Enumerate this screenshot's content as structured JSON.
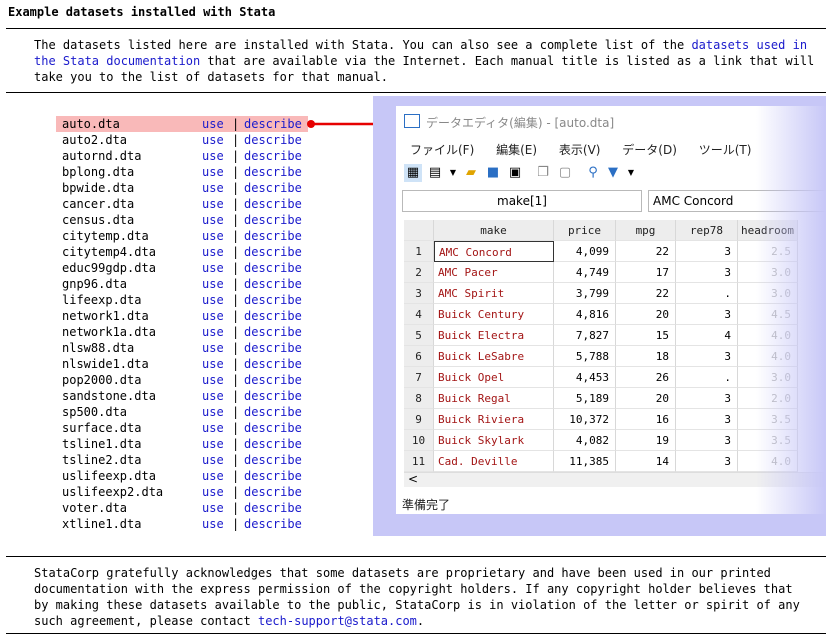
{
  "page": {
    "title": "Example datasets installed with Stata",
    "intro_1": "The datasets listed here are installed with Stata.  You can also see a complete list of the ",
    "intro_link": "datasets used in the Stata documentation",
    "intro_2": " that are available via the Internet.  Each manual title is listed as a link that will take you to the list of datasets for that manual.",
    "use_label": "use",
    "sep": "|",
    "describe_label": "describe",
    "datasets": [
      "auto.dta",
      "auto2.dta",
      "autornd.dta",
      "bplong.dta",
      "bpwide.dta",
      "cancer.dta",
      "census.dta",
      "citytemp.dta",
      "citytemp4.dta",
      "educ99gdp.dta",
      "gnp96.dta",
      "lifeexp.dta",
      "network1.dta",
      "network1a.dta",
      "nlsw88.dta",
      "nlswide1.dta",
      "pop2000.dta",
      "sandstone.dta",
      "sp500.dta",
      "surface.dta",
      "tsline1.dta",
      "tsline2.dta",
      "uslifeexp.dta",
      "uslifeexp2.dta",
      "voter.dta",
      "xtline1.dta"
    ],
    "highlighted": "auto.dta",
    "foot_1": "StataCorp gratefully acknowledges that some datasets are proprietary and have been used in our printed documentation with the express permission of the copyright holders. If any copyright holder believes that by making these datasets available to the public, StataCorp is in violation of the letter or spirit of any such agreement, please contact ",
    "foot_link": "tech-support@stata.com",
    "foot_2": "."
  },
  "editor": {
    "title": "データエディタ(編集) - [auto.dta]",
    "menus": [
      "ファイル(F)",
      "編集(E)",
      "表示(V)",
      "データ(D)",
      "ツール(T)"
    ],
    "cell_ref": "make[1]",
    "cell_value": "AMC Concord",
    "columns": [
      "make",
      "price",
      "mpg",
      "rep78",
      "headroom"
    ],
    "rows": [
      [
        "1",
        "AMC Concord",
        "4,099",
        "22",
        "3",
        "2.5"
      ],
      [
        "2",
        "AMC Pacer",
        "4,749",
        "17",
        "3",
        "3.0"
      ],
      [
        "3",
        "AMC Spirit",
        "3,799",
        "22",
        ".",
        "3.0"
      ],
      [
        "4",
        "Buick Century",
        "4,816",
        "20",
        "3",
        "4.5"
      ],
      [
        "5",
        "Buick Electra",
        "7,827",
        "15",
        "4",
        "4.0"
      ],
      [
        "6",
        "Buick LeSabre",
        "5,788",
        "18",
        "3",
        "4.0"
      ],
      [
        "7",
        "Buick Opel",
        "4,453",
        "26",
        ".",
        "3.0"
      ],
      [
        "8",
        "Buick Regal",
        "5,189",
        "20",
        "3",
        "2.0"
      ],
      [
        "9",
        "Buick Riviera",
        "10,372",
        "16",
        "3",
        "3.5"
      ],
      [
        "10",
        "Buick Skylark",
        "4,082",
        "19",
        "3",
        "3.5"
      ],
      [
        "11",
        "Cad. Deville",
        "11,385",
        "14",
        "3",
        "4.0"
      ]
    ],
    "status": "準備完了",
    "scroll_left": "<"
  },
  "colors": {
    "link": "#1a1acc",
    "highlight": "#f9b9b9",
    "arrow": "#e60000",
    "panel": "#c7c7f7"
  }
}
